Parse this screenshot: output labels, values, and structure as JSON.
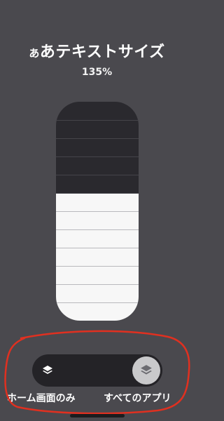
{
  "title": {
    "prefix": "あ",
    "text": "あテキストサイズ"
  },
  "text_size": {
    "percent_label": "135%",
    "steps_total": 12,
    "steps_filled": 7
  },
  "toggle": {
    "left_icon": "layers-icon",
    "right_icon": "layers-icon",
    "selected": "right"
  },
  "labels": {
    "home_screen_only": "ホーム画面のみ",
    "all_apps": "すべてのアプリ"
  },
  "colors": {
    "background": "#4a494e",
    "slider_dark": "#2a292e",
    "slider_light": "#f7f7f7",
    "annotation": "#e03020"
  }
}
